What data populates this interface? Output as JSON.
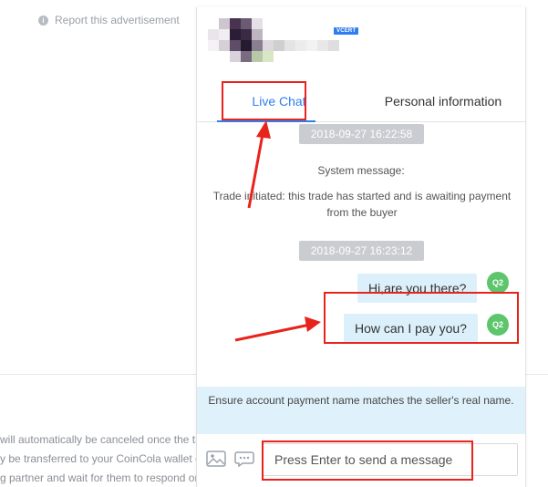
{
  "background": {
    "report_label": "Report this advertisement",
    "info_glyph": "i",
    "text_lines": [
      "will automatically be canceled once the tr",
      "y be transferred to your CoinCola wallet o",
      "g partner and wait for them to respond on"
    ]
  },
  "profile": {
    "verified_badge": "VCERT"
  },
  "tabs": [
    {
      "label": "Live Chat",
      "active": true
    },
    {
      "label": "Personal information",
      "active": false
    }
  ],
  "messages": {
    "timestamp_1": "2018-09-27 16:22:58",
    "system_title": "System message:",
    "system_body": "Trade initiated: this trade has started and is awaiting payment from the buyer",
    "timestamp_2": "2018-09-27 16:23:12",
    "user_messages": [
      {
        "text": "Hi,are you there?",
        "avatar": "Q2"
      },
      {
        "text": "How can I pay you?",
        "avatar": "Q2"
      }
    ]
  },
  "notice": "Ensure account payment name matches the seller's real name.",
  "composer": {
    "placeholder": "Press Enter to send a message",
    "image_icon": "image-icon",
    "emoji_icon": "emoji-icon"
  },
  "colors": {
    "accent": "#2f7ef0",
    "bubble": "#dcf0fb",
    "notice_bg": "#dff2fc",
    "avatar_green": "#5dc56b",
    "annotation_red": "#e8231b"
  }
}
